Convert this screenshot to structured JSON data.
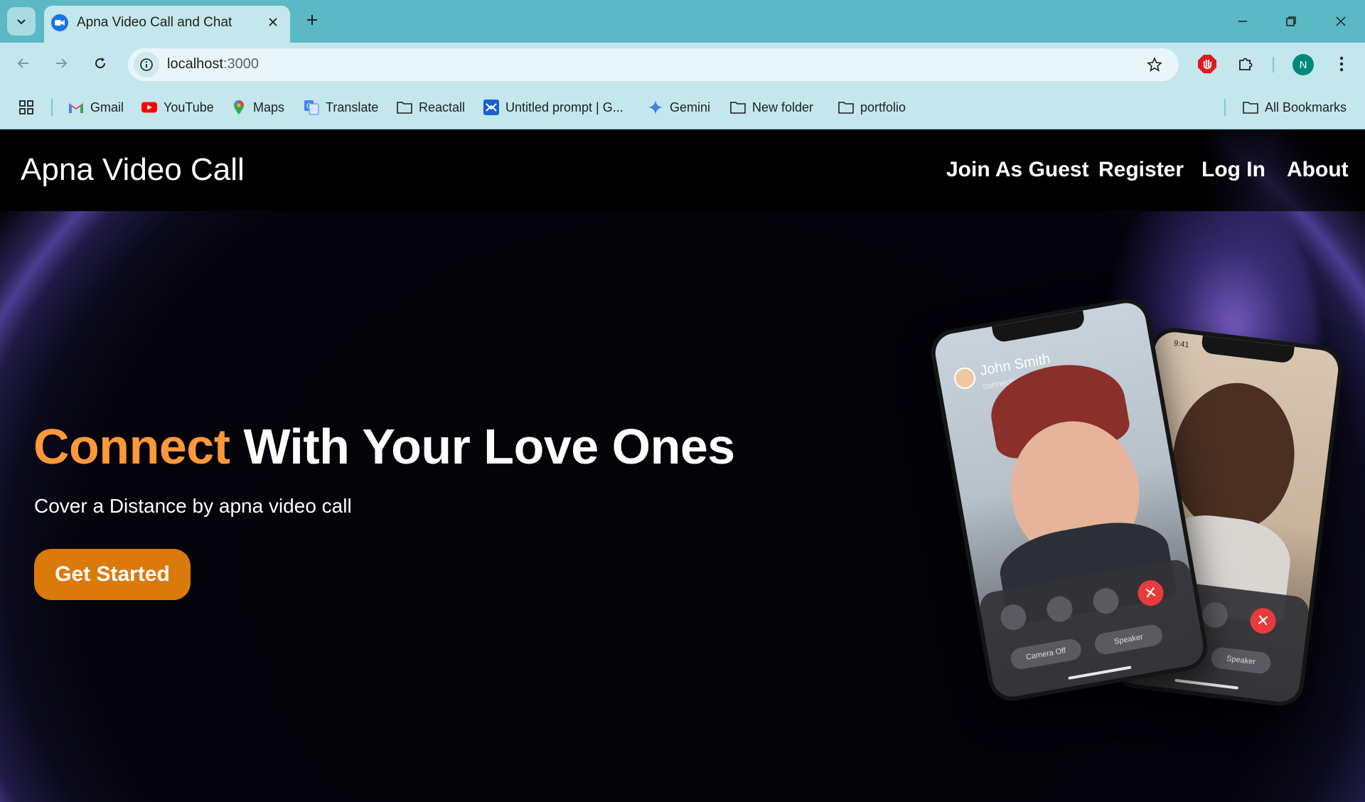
{
  "browser": {
    "tab_title": "Apna Video Call and Chat",
    "url_host": "localhost",
    "url_port": ":3000",
    "profile_initial": "N",
    "bookmarks": [
      {
        "label": "Gmail",
        "icon": "gmail-icon"
      },
      {
        "label": "YouTube",
        "icon": "youtube-icon"
      },
      {
        "label": "Maps",
        "icon": "maps-icon"
      },
      {
        "label": "Translate",
        "icon": "translate-icon"
      },
      {
        "label": "Reactall",
        "icon": "folder-icon"
      },
      {
        "label": "Untitled prompt | G...",
        "icon": "ai-studio-icon"
      },
      {
        "label": "Gemini",
        "icon": "gemini-icon"
      },
      {
        "label": "New folder",
        "icon": "folder-icon"
      },
      {
        "label": "portfolio",
        "icon": "folder-icon"
      }
    ],
    "all_bookmarks": "All Bookmarks",
    "colors": {
      "frame": "#5bb8c4",
      "toolbar": "#c3e7ec"
    }
  },
  "site": {
    "brand": "Apna Video Call",
    "nav": [
      "Join As Guest",
      "Register",
      "Log In",
      "About"
    ],
    "hero": {
      "title_accent": "Connect",
      "title_rest": " With Your Love Ones",
      "subtitle": "Cover a Distance by apna video call",
      "cta": "Get Started"
    },
    "colors": {
      "accent": "#ff9839",
      "button": "#d97a0b",
      "background": "#000000"
    }
  },
  "mockup": {
    "caller_name": "John Smith",
    "caller_status": "connecting",
    "clock": "9:41",
    "camera_off": "Camera Off",
    "speaker": "Speaker"
  }
}
